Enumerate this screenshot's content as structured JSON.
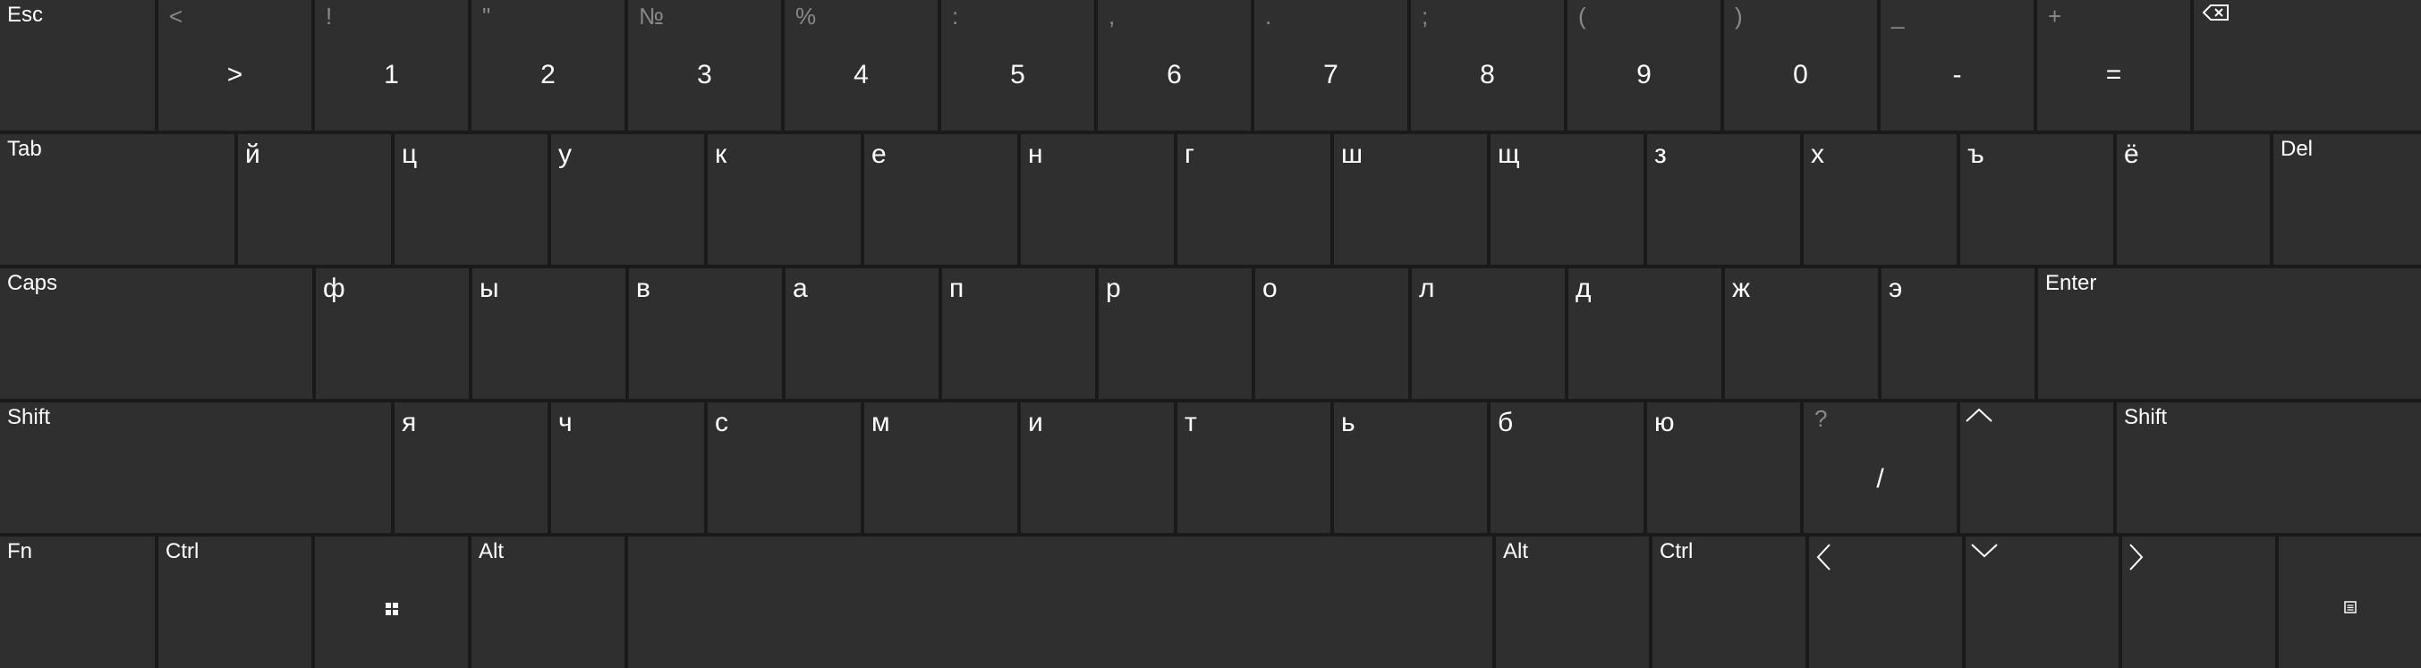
{
  "keyboard": {
    "layout": "Russian (ЙЦУКЕН)",
    "colors": {
      "background": "#1a1a1a",
      "key": "#2f2f2f",
      "text": "#ffffff",
      "secondary_text": "#8a8a8a"
    },
    "row1": {
      "esc": "Esc",
      "keys": [
        {
          "secondary": "<",
          "primary": ">"
        },
        {
          "secondary": "!",
          "primary": "1"
        },
        {
          "secondary": "\"",
          "primary": "2"
        },
        {
          "secondary": "№",
          "primary": "3"
        },
        {
          "secondary": "%",
          "primary": "4"
        },
        {
          "secondary": ":",
          "primary": "5"
        },
        {
          "secondary": ",",
          "primary": "6"
        },
        {
          "secondary": ".",
          "primary": "7"
        },
        {
          "secondary": ";",
          "primary": "8"
        },
        {
          "secondary": "(",
          "primary": "9"
        },
        {
          "secondary": ")",
          "primary": "0"
        },
        {
          "secondary": "_",
          "primary": "-"
        },
        {
          "secondary": "+",
          "primary": "="
        }
      ],
      "backspace_icon": "backspace-icon"
    },
    "row2": {
      "tab": "Tab",
      "letters": [
        "й",
        "ц",
        "у",
        "к",
        "е",
        "н",
        "г",
        "ш",
        "щ",
        "з",
        "х",
        "ъ",
        "ё"
      ],
      "del": "Del"
    },
    "row3": {
      "caps": "Caps",
      "letters": [
        "ф",
        "ы",
        "в",
        "а",
        "п",
        "р",
        "о",
        "л",
        "д",
        "ж",
        "э"
      ],
      "enter": "Enter"
    },
    "row4": {
      "shift_left": "Shift",
      "letters": [
        "я",
        "ч",
        "с",
        "м",
        "и",
        "т",
        "ь",
        "б",
        "ю"
      ],
      "slash_secondary": "?",
      "slash_primary": "/",
      "up_icon": "arrow-up-icon",
      "shift_right": "Shift"
    },
    "row5": {
      "fn": "Fn",
      "ctrl_left": "Ctrl",
      "win_icon": "windows-icon",
      "alt_left": "Alt",
      "space": "",
      "alt_right": "Alt",
      "ctrl_right": "Ctrl",
      "left_icon": "arrow-left-icon",
      "down_icon": "arrow-down-icon",
      "right_icon": "arrow-right-icon",
      "menu_icon": "menu-icon"
    }
  }
}
